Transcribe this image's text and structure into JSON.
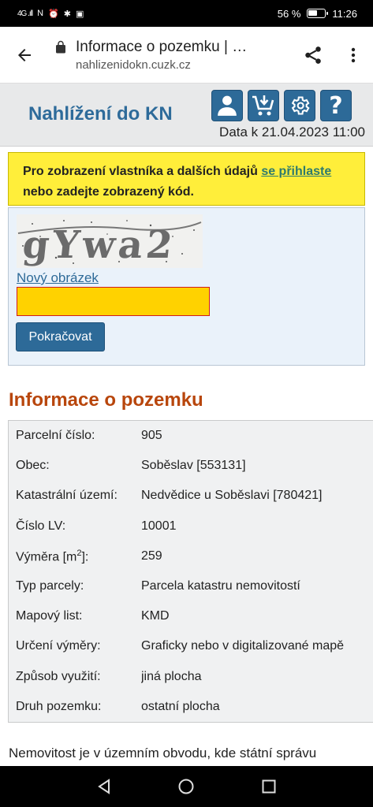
{
  "status_bar": {
    "signal": "4G .ıll",
    "battery_percent": "56 %",
    "battery_level": 0.56,
    "time": "11:26"
  },
  "browser": {
    "page_title": "Informace o pozemku | …",
    "domain": "nahlizenidokn.cuzk.cz"
  },
  "site": {
    "title": "Nahlížení do KN",
    "data_date": "Data k 21.04.2023 11:00",
    "icons": [
      "user-icon",
      "cart-download-icon",
      "gear-icon",
      "help-icon"
    ],
    "accent_color": "#2d6a98"
  },
  "notice": {
    "prefix": "Pro zobrazení vlastníka a dalších údajů ",
    "link": "se přihlaste",
    "suffix": " nebo zadejte zobrazený kód."
  },
  "captcha": {
    "image_text": "gYwa2",
    "new_image_label": "Nový obrázek",
    "input_value": "",
    "continue_label": "Pokračovat"
  },
  "section_title": "Informace o pozemku",
  "parcel_info": [
    {
      "label": "Parcelní číslo:",
      "value": "905"
    },
    {
      "label": "Obec:",
      "value": "Soběslav [553131]"
    },
    {
      "label": "Katastrální území:",
      "value": "Nedvědice u Soběslavi [780421]"
    },
    {
      "label": "Číslo LV:",
      "value": "10001"
    },
    {
      "label_prefix": "Výměra [m",
      "label_sup": "2",
      "label_suffix": "]:",
      "value": "259"
    },
    {
      "label": "Typ parcely:",
      "value": "Parcela katastru nemovitostí"
    },
    {
      "label": "Mapový list:",
      "value": "KMD"
    },
    {
      "label": "Určení výměry:",
      "value": "Graficky nebo v digitalizované mapě"
    },
    {
      "label": "Způsob využití:",
      "value": "jiná plocha"
    },
    {
      "label": "Druh pozemku:",
      "value": "ostatní plocha"
    }
  ],
  "footer_text": "Nemovitost je v územním obvodu, kde státní správu"
}
